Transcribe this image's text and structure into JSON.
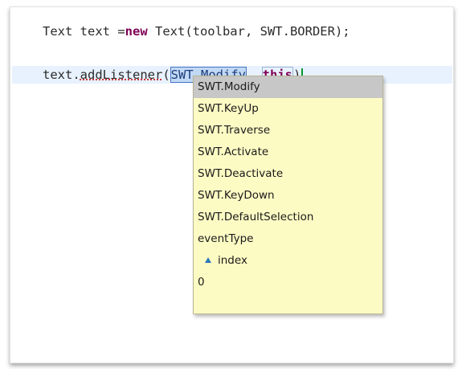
{
  "editor": {
    "line1": {
      "prefix": "Text text =",
      "keyword": "new",
      "suffix": " Text(toolbar, SWT.BORDER);"
    },
    "line2": {
      "receiver": "text.",
      "method": "addListener",
      "open_paren": "(",
      "selected_arg": "SWT.Modify",
      "separator": ", ",
      "this_keyword": "this",
      "close_paren": ")"
    }
  },
  "completion_popup": {
    "items": [
      {
        "label": "SWT.Modify",
        "selected": true
      },
      {
        "label": "SWT.KeyUp"
      },
      {
        "label": "SWT.Traverse"
      },
      {
        "label": "SWT.Activate"
      },
      {
        "label": "SWT.Deactivate"
      },
      {
        "label": "SWT.KeyDown"
      },
      {
        "label": "SWT.DefaultSelection"
      },
      {
        "label": "eventType"
      },
      {
        "label": "index",
        "icon": "field-triangle-icon"
      },
      {
        "label": "0"
      }
    ]
  },
  "colors": {
    "keyword": "#7f0055",
    "current_line_highlight": "#e8f2fe",
    "popup_background": "#fdfbc4",
    "popup_selection": "#c7c7c7",
    "caret": "#009933"
  }
}
